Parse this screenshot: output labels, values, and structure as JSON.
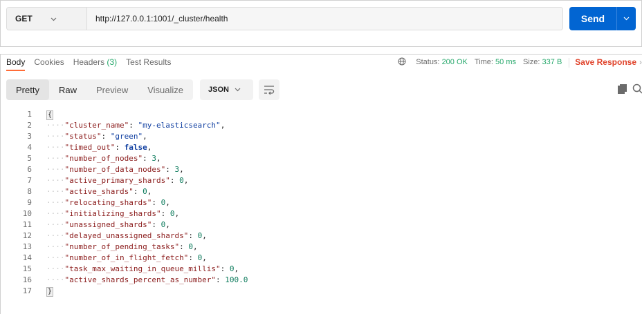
{
  "request": {
    "method": "GET",
    "url": "http://127.0.0.1:1001/_cluster/health",
    "send_label": "Send"
  },
  "response_tabs": [
    {
      "label": "Body",
      "count": ""
    },
    {
      "label": "Cookies",
      "count": ""
    },
    {
      "label": "Headers",
      "count": "(3)"
    },
    {
      "label": "Test Results",
      "count": ""
    }
  ],
  "status_bar": {
    "status_label": "Status:",
    "status_value": "200 OK",
    "time_label": "Time:",
    "time_value": "50 ms",
    "size_label": "Size:",
    "size_value": "337 B",
    "save_label": "Save Response"
  },
  "view_tabs": [
    {
      "label": "Pretty"
    },
    {
      "label": "Raw"
    },
    {
      "label": "Preview"
    },
    {
      "label": "Visualize"
    }
  ],
  "format": "JSON",
  "icons": {
    "globe": "globe-icon",
    "wrap": "wrap-lines-icon",
    "copy": "copy-icon",
    "search": "search-icon",
    "chevron": "chevron-down-icon"
  },
  "colors": {
    "send_button": "#0265d2",
    "status_green": "#26a86b",
    "save_red": "#e0432b",
    "active_tab_underline": "#ff6c37"
  },
  "code_lines": [
    {
      "num": "1",
      "kind": "open",
      "text": "{"
    },
    {
      "num": "2",
      "kind": "pair",
      "key": "\"cluster_name\"",
      "value": "\"my-elasticsearch\"",
      "vtype": "str",
      "comma": ","
    },
    {
      "num": "3",
      "kind": "pair",
      "key": "\"status\"",
      "value": "\"green\"",
      "vtype": "str",
      "comma": ","
    },
    {
      "num": "4",
      "kind": "pair",
      "key": "\"timed_out\"",
      "value": "false",
      "vtype": "bool",
      "comma": ","
    },
    {
      "num": "5",
      "kind": "pair",
      "key": "\"number_of_nodes\"",
      "value": "3",
      "vtype": "num",
      "comma": ","
    },
    {
      "num": "6",
      "kind": "pair",
      "key": "\"number_of_data_nodes\"",
      "value": "3",
      "vtype": "num",
      "comma": ","
    },
    {
      "num": "7",
      "kind": "pair",
      "key": "\"active_primary_shards\"",
      "value": "0",
      "vtype": "num",
      "comma": ","
    },
    {
      "num": "8",
      "kind": "pair",
      "key": "\"active_shards\"",
      "value": "0",
      "vtype": "num",
      "comma": ","
    },
    {
      "num": "9",
      "kind": "pair",
      "key": "\"relocating_shards\"",
      "value": "0",
      "vtype": "num",
      "comma": ","
    },
    {
      "num": "10",
      "kind": "pair",
      "key": "\"initializing_shards\"",
      "value": "0",
      "vtype": "num",
      "comma": ","
    },
    {
      "num": "11",
      "kind": "pair",
      "key": "\"unassigned_shards\"",
      "value": "0",
      "vtype": "num",
      "comma": ","
    },
    {
      "num": "12",
      "kind": "pair",
      "key": "\"delayed_unassigned_shards\"",
      "value": "0",
      "vtype": "num",
      "comma": ","
    },
    {
      "num": "13",
      "kind": "pair",
      "key": "\"number_of_pending_tasks\"",
      "value": "0",
      "vtype": "num",
      "comma": ","
    },
    {
      "num": "14",
      "kind": "pair",
      "key": "\"number_of_in_flight_fetch\"",
      "value": "0",
      "vtype": "num",
      "comma": ","
    },
    {
      "num": "15",
      "kind": "pair",
      "key": "\"task_max_waiting_in_queue_millis\"",
      "value": "0",
      "vtype": "num",
      "comma": ","
    },
    {
      "num": "16",
      "kind": "pair",
      "key": "\"active_shards_percent_as_number\"",
      "value": "100.0",
      "vtype": "num",
      "comma": ""
    },
    {
      "num": "17",
      "kind": "close",
      "text": "}"
    }
  ]
}
